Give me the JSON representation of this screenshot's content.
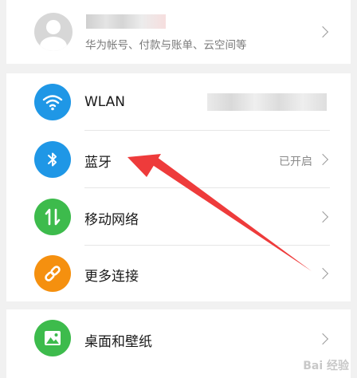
{
  "account": {
    "subtitle": "华为帐号、付款与账单、云空间等"
  },
  "connect_items": [
    {
      "label": "WLAN",
      "value": "",
      "icon": "wifi-icon",
      "color": "#1f97e6"
    },
    {
      "label": "蓝牙",
      "value": "已开启",
      "icon": "bluetooth-icon",
      "color": "#1f97e6"
    },
    {
      "label": "移动网络",
      "value": "",
      "icon": "mobile-data-icon",
      "color": "#3dbb4c"
    },
    {
      "label": "更多连接",
      "value": "",
      "icon": "link-icon",
      "color": "#f5900f"
    }
  ],
  "display_items": [
    {
      "label": "桌面和壁纸",
      "icon": "wallpaper-icon",
      "color": "#3dbb4c"
    }
  ],
  "annotation": {
    "color": "#ee3b3b"
  },
  "watermark": "Bai 经验"
}
